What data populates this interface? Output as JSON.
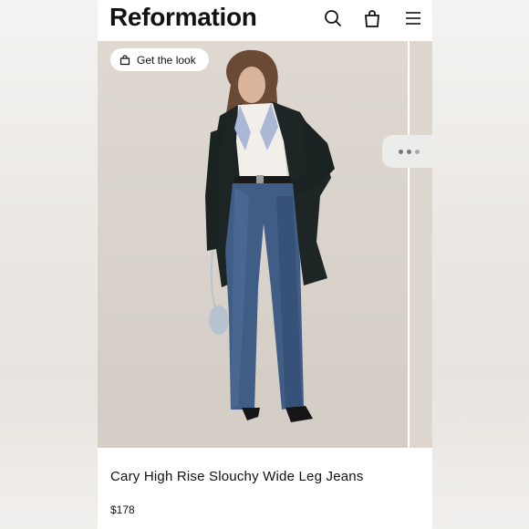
{
  "header": {
    "logo": "Reformation",
    "icons": [
      "search-icon",
      "shopping-bag-icon",
      "hamburger-menu-icon"
    ]
  },
  "hero": {
    "get_the_look_label": "Get the look",
    "more_indicator": "..."
  },
  "product": {
    "title": "Cary High Rise Slouchy Wide Leg Jeans",
    "price": "$178"
  },
  "colors": {
    "background": "#ffffff",
    "text": "#111111",
    "hero_bg": "#dcd6cf",
    "denim": "#3f5d85"
  }
}
